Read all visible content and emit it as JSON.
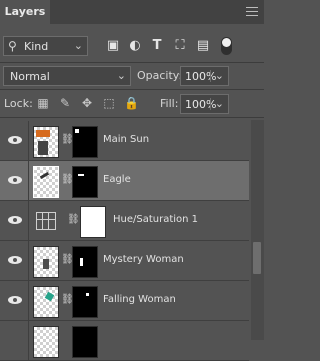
{
  "panel": {
    "title": "Layers"
  },
  "filter": {
    "kind_label": "Kind"
  },
  "blend": {
    "mode": "Normal",
    "opacity_label": "Opacity:",
    "opacity_value": "100%"
  },
  "lock": {
    "label": "Lock:",
    "fill_label": "Fill:",
    "fill_value": "100%"
  },
  "layers": [
    {
      "name": "Main Sun",
      "visible": true,
      "selected": false
    },
    {
      "name": "Eagle",
      "visible": true,
      "selected": true
    },
    {
      "name": "Hue/Saturation 1",
      "visible": true,
      "selected": false,
      "type": "adjustment"
    },
    {
      "name": "Mystery Woman",
      "visible": true,
      "selected": false
    },
    {
      "name": "Falling Woman",
      "visible": true,
      "selected": false
    }
  ],
  "colors": {
    "panel_bg": "#535353",
    "selected_row": "#6e6e6e",
    "header_bg": "#424242"
  }
}
